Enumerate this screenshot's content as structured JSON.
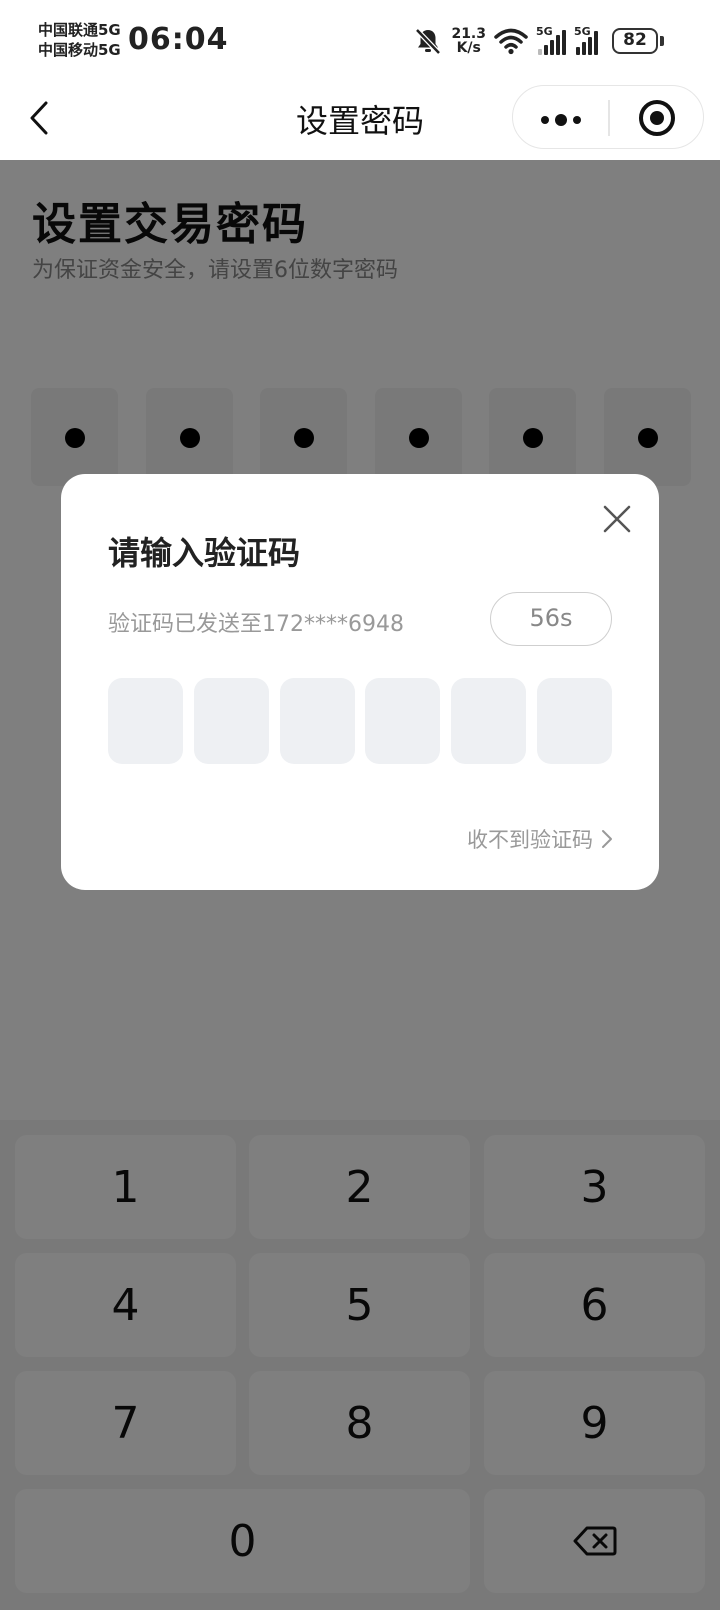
{
  "status_bar": {
    "carrier_1": "中国联通5G",
    "carrier_2": "中国移动5G",
    "time": "06:04",
    "net_speed_value": "21.3",
    "net_speed_unit": "K/s",
    "sim1_label": "5G",
    "sim2_label": "5G",
    "battery": "82",
    "icons": [
      "bell-off-icon",
      "wifi-icon",
      "signal-icon",
      "signal-icon",
      "battery-icon"
    ]
  },
  "nav": {
    "title": "设置密码",
    "back_icon": "chevron-left-icon",
    "more_icon": "more-dots-icon",
    "close_icon": "target-circle-icon"
  },
  "page": {
    "title": "设置交易密码",
    "subtitle": "为保证资金安全，请设置6位数字密码",
    "password_digits_filled": 6,
    "password_length": 6
  },
  "dialog": {
    "title": "请输入验证码",
    "sent_to_text": "验证码已发送至172****6948",
    "countdown": "56s",
    "code_length": 6,
    "no_code_link": "收不到验证码",
    "close_icon": "close-x-icon"
  },
  "keypad": {
    "keys": [
      "1",
      "2",
      "3",
      "4",
      "5",
      "6",
      "7",
      "8",
      "9",
      "0"
    ],
    "delete_icon": "backspace-icon"
  },
  "colors": {
    "overlay": "#000000",
    "code_box": "#eef0f3",
    "keypad_bg": "#f3f3f3",
    "muted_text": "#999999"
  }
}
